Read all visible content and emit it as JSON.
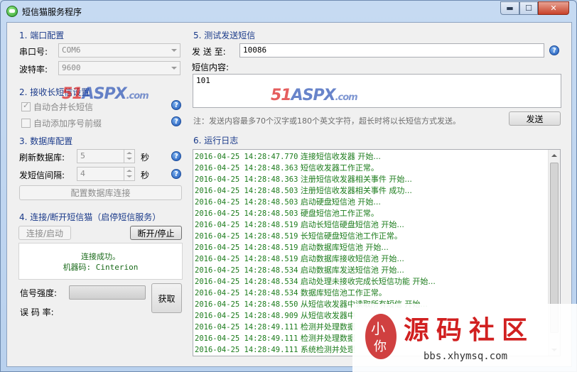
{
  "window": {
    "title": "短信猫服务程序",
    "min_label": "▬",
    "max_label": "☐",
    "close_label": "✕"
  },
  "port": {
    "group_title": "1. 端口配置",
    "port_label": "串口号:",
    "port_value": "COM6",
    "baud_label": "波特率:",
    "baud_value": "9600"
  },
  "longsms": {
    "group_title": "2. 接收长短信设置",
    "auto_merge_label": "自动合并长短信",
    "auto_prefix_label": "自动添加序号前缀"
  },
  "db": {
    "group_title": "3. 数据库配置",
    "refresh_label": "刷新数据库:",
    "refresh_value": "5",
    "refresh_unit": "秒",
    "send_label": "发短信间隔:",
    "send_value": "4",
    "send_unit": "秒",
    "config_button": "配置数据库连接"
  },
  "conn": {
    "group_title": "4. 连接/断开短信猫（启停短信服务）",
    "connect_button": "连接/启动",
    "disconnect_button": "断开/停止",
    "status_line1": "连接成功。",
    "status_line2": "机器码: Cinterion",
    "signal_label": "信号强度:",
    "error_label": "误 码 率:",
    "get_button": "获取"
  },
  "test": {
    "group_title": "5. 测试发送短信",
    "to_label": "发 送 至:",
    "to_value": "10086",
    "content_label": "短信内容:",
    "content_value": "101",
    "note": "注：发送内容最多70个汉字或180个英文字符，超长时将以长短信方式发送。",
    "send_button": "发送"
  },
  "log": {
    "group_title": "6. 运行日志",
    "lines": [
      {
        "ts": "2016-04-25 14:28:47.770",
        "msg": "连接短信收发器 开始..."
      },
      {
        "ts": "2016-04-25 14:28:48.363",
        "msg": "短信收发器工作正常。"
      },
      {
        "ts": "2016-04-25 14:28:48.363",
        "msg": "注册短信收发器相关事件 开始..."
      },
      {
        "ts": "2016-04-25 14:28:48.503",
        "msg": "注册短信收发器相关事件 成功..."
      },
      {
        "ts": "2016-04-25 14:28:48.503",
        "msg": "启动硬盘短信池 开始..."
      },
      {
        "ts": "2016-04-25 14:28:48.503",
        "msg": "硬盘短信池工作正常。"
      },
      {
        "ts": "2016-04-25 14:28:48.519",
        "msg": "启动长短信硬盘短信池 开始..."
      },
      {
        "ts": "2016-04-25 14:28:48.519",
        "msg": "长短信硬盘短信池工作正常。"
      },
      {
        "ts": "2016-04-25 14:28:48.519",
        "msg": "启动数据库短信池 开始..."
      },
      {
        "ts": "2016-04-25 14:28:48.519",
        "msg": "启动数据库接收短信池 开始..."
      },
      {
        "ts": "2016-04-25 14:28:48.534",
        "msg": "启动数据库发送短信池 开始..."
      },
      {
        "ts": "2016-04-25 14:28:48.534",
        "msg": "启动处理未接收完成长短信功能 开始..."
      },
      {
        "ts": "2016-04-25 14:28:48.534",
        "msg": "数据库短信池工作正常。"
      },
      {
        "ts": "2016-04-25 14:28:48.550",
        "msg": "从短信收发器中读取所有短信 开始..."
      },
      {
        "ts": "2016-04-25 14:28:48.909",
        "msg": "从短信收发器中"
      },
      {
        "ts": "2016-04-25 14:28:49.111",
        "msg": "检测并处理数据"
      },
      {
        "ts": "2016-04-25 14:28:49.111",
        "msg": "检测并处理数据"
      },
      {
        "ts": "2016-04-25 14:28:49.111",
        "msg": "系统检测并处理"
      }
    ]
  },
  "watermark": {
    "mid_51": "51",
    "mid_aspx": "ASPX",
    "mid_com": ".com",
    "brand_logo_text": "小 你",
    "brand_title": "源码社区",
    "brand_url": "bbs.xhymsq.com"
  },
  "colors": {
    "group_title": "#1a3a8a",
    "log_text": "#1c7c1c",
    "close_button": "#c8422a",
    "brand_red": "#d12020"
  },
  "icons": [
    "app-icon",
    "help-icon",
    "dropdown-arrow-icon",
    "spin-updown-icon",
    "scroll-up-icon",
    "scroll-down-icon"
  ]
}
